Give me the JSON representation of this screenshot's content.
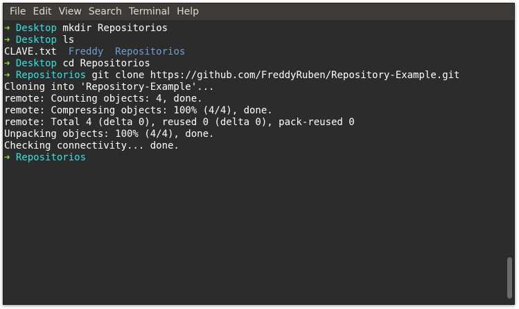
{
  "menu": [
    "File",
    "Edit",
    "View",
    "Search",
    "Terminal",
    "Help"
  ],
  "prompt_arrow": "➜",
  "lines": [
    {
      "type": "prompt",
      "dir": "Desktop",
      "cmd": "mkdir Repositorios"
    },
    {
      "type": "prompt",
      "dir": "Desktop",
      "cmd": "ls"
    },
    {
      "type": "ls",
      "file": "CLAVE.txt",
      "sep1": "  ",
      "folder1": "Freddy",
      "sep2": "  ",
      "folder2": "Repositorios"
    },
    {
      "type": "prompt",
      "dir": "Desktop",
      "cmd": "cd Repositorios"
    },
    {
      "type": "prompt",
      "dir": "Repositorios",
      "cmd": "git clone https://github.com/FreddyRuben/Repository-Example.git"
    },
    {
      "type": "output",
      "text": "Cloning into 'Repository-Example'..."
    },
    {
      "type": "output",
      "text": "remote: Counting objects: 4, done."
    },
    {
      "type": "output",
      "text": "remote: Compressing objects: 100% (4/4), done."
    },
    {
      "type": "output",
      "text": "remote: Total 4 (delta 0), reused 0 (delta 0), pack-reused 0"
    },
    {
      "type": "output",
      "text": "Unpacking objects: 100% (4/4), done."
    },
    {
      "type": "output",
      "text": "Checking connectivity... done."
    },
    {
      "type": "prompt",
      "dir": "Repositorios",
      "cmd": ""
    }
  ],
  "colors": {
    "background": "#2c2c2c",
    "menubar": "#3c3b37",
    "prompt_arrow": "#8ae234",
    "prompt_dir": "#34e2e2",
    "ls_folder": "#729fcf",
    "text": "#ffffff"
  }
}
